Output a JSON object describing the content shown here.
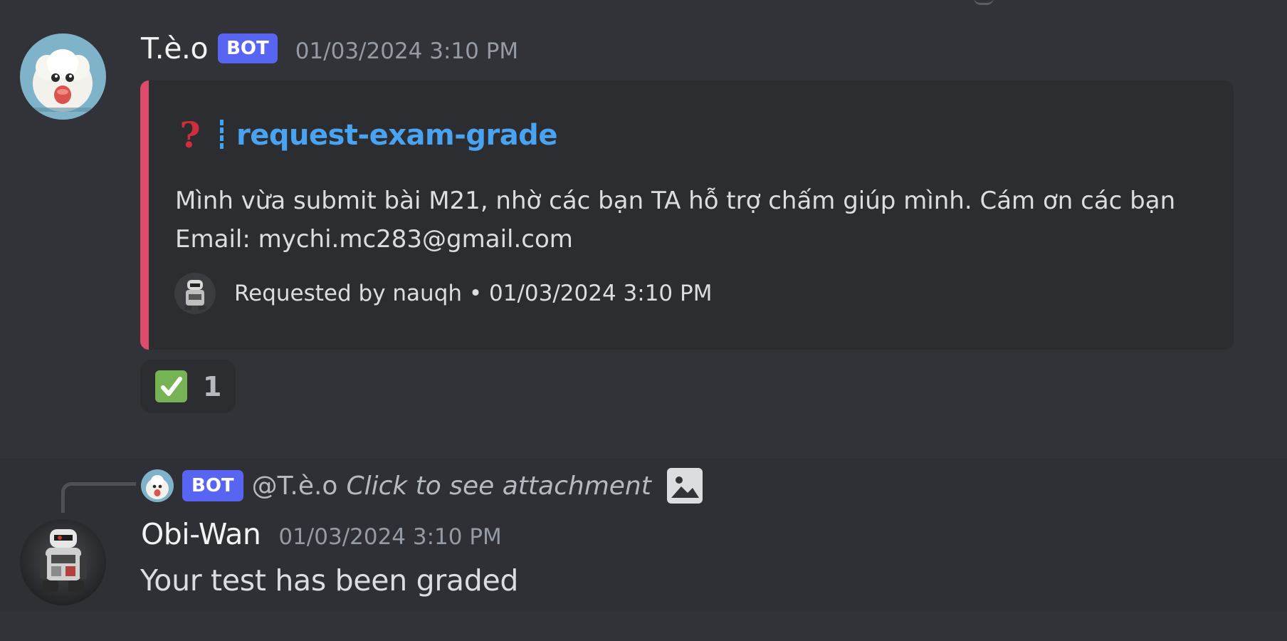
{
  "messages": [
    {
      "author": "T.è.o",
      "badge": "BOT",
      "timestamp": "01/03/2024 3:10 PM",
      "embed": {
        "accent_color": "#dd4c6b",
        "title_icon": "question-icon",
        "title": "request-exam-grade",
        "description_lines": [
          "Mình vừa submit bài M21, nhờ các bạn TA hỗ trợ chấm giúp mình. Cám ơn các bạn",
          "Email: mychi.mc283@gmail.com"
        ],
        "footer": "Requested by nauqh • 01/03/2024 3:10 PM"
      },
      "reaction": {
        "emoji": "check-mark-icon",
        "count": "1"
      }
    },
    {
      "reply": {
        "badge": "BOT",
        "mention": "@T.è.o",
        "preview": "Click to see attachment",
        "attachment_icon": "image-icon"
      },
      "author": "Obi-Wan",
      "timestamp": "01/03/2024 3:10 PM",
      "content": "Your test has been graded"
    }
  ],
  "colors": {
    "background": "#313338",
    "bot_badge": "#5865f2",
    "link_title": "#4aa3f0"
  }
}
